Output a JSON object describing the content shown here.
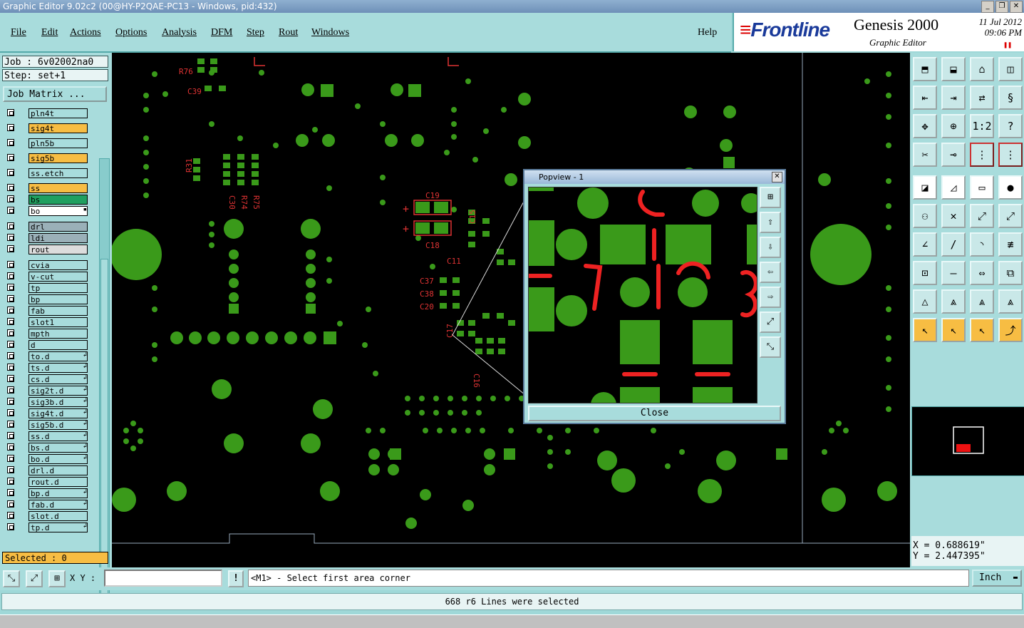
{
  "window": {
    "title": "Graphic Editor 9.02c2 (00@HY-P2QAE-PC13 - Windows, pid:432)",
    "btn_min": "_",
    "btn_max": "❐",
    "btn_close": "✕"
  },
  "menu": {
    "items": [
      "File",
      "Edit",
      "Actions",
      "Options",
      "Analysis",
      "DFM",
      "Step",
      "Rout",
      "Windows"
    ],
    "help": "Help"
  },
  "brand": {
    "logo": "Frontline",
    "logo_mark": "≡",
    "product": "Genesis 2000",
    "subtitle": "Graphic Editor",
    "date": "11 Jul 2012",
    "time": "09:06 PM",
    "pause_icon": "❚❚"
  },
  "job": {
    "job_line": "Job : 6v02002na0",
    "step_line": "Step: set+1",
    "matrix_button": "Job Matrix ..."
  },
  "layers": [
    {
      "name": "pln4t",
      "color": "#a8dcdc",
      "arrow": ""
    },
    {
      "name": "sig4t",
      "color": "#f7bd43",
      "arrow": ""
    },
    {
      "name": "pln5b",
      "color": "#a8dcdc",
      "arrow": ""
    },
    {
      "name": "sig5b",
      "color": "#f7bd43",
      "arrow": ""
    },
    {
      "name": "ss.etch",
      "color": "#a8dcdc",
      "arrow": ""
    },
    {
      "name": "ss",
      "color": "#f7bd43",
      "arrow": ""
    },
    {
      "name": "bs",
      "color": "#20a060",
      "arrow": ""
    },
    {
      "name": "bo",
      "color": "#ffffff",
      "arrow": "▪"
    },
    {
      "name": "drl",
      "color": "#9ab0b8",
      "arrow": ""
    },
    {
      "name": "ldi",
      "color": "#9ab0b8",
      "arrow": ""
    },
    {
      "name": "rout",
      "color": "#dcdcdc",
      "arrow": ""
    },
    {
      "name": "cvia",
      "color": "#a8dcdc",
      "arrow": ""
    },
    {
      "name": "v-cut",
      "color": "#a8dcdc",
      "arrow": ""
    },
    {
      "name": "tp",
      "color": "#a8dcdc",
      "arrow": ""
    },
    {
      "name": "bp",
      "color": "#a8dcdc",
      "arrow": ""
    },
    {
      "name": "fab",
      "color": "#a8dcdc",
      "arrow": ""
    },
    {
      "name": "slot1",
      "color": "#a8dcdc",
      "arrow": ""
    },
    {
      "name": "mpth",
      "color": "#a8dcdc",
      "arrow": ""
    },
    {
      "name": "d",
      "color": "#a8dcdc",
      "arrow": ""
    },
    {
      "name": "to.d",
      "color": "#a8dcdc",
      "arrow": "↲"
    },
    {
      "name": "ts.d",
      "color": "#a8dcdc",
      "arrow": "↲"
    },
    {
      "name": "cs.d",
      "color": "#a8dcdc",
      "arrow": "↲"
    },
    {
      "name": "sig2t.d",
      "color": "#a8dcdc",
      "arrow": "↲"
    },
    {
      "name": "sig3b.d",
      "color": "#a8dcdc",
      "arrow": "↲"
    },
    {
      "name": "sig4t.d",
      "color": "#a8dcdc",
      "arrow": "↲"
    },
    {
      "name": "sig5b.d",
      "color": "#a8dcdc",
      "arrow": "↲"
    },
    {
      "name": "ss.d",
      "color": "#a8dcdc",
      "arrow": "↲"
    },
    {
      "name": "bs.d",
      "color": "#a8dcdc",
      "arrow": "↲"
    },
    {
      "name": "bo.d",
      "color": "#a8dcdc",
      "arrow": "↲"
    },
    {
      "name": "drl.d",
      "color": "#a8dcdc",
      "arrow": ""
    },
    {
      "name": "rout.d",
      "color": "#a8dcdc",
      "arrow": ""
    },
    {
      "name": "bp.d",
      "color": "#a8dcdc",
      "arrow": "↲"
    },
    {
      "name": "fab.d",
      "color": "#a8dcdc",
      "arrow": "↲"
    },
    {
      "name": "slot.d",
      "color": "#a8dcdc",
      "arrow": ""
    },
    {
      "name": "tp.d",
      "color": "#a8dcdc",
      "arrow": "↲"
    }
  ],
  "selected": "Selected : 0",
  "canvas_labels": {
    "r76": "R76",
    "c39": "C39",
    "r31": "R31",
    "c30": "C30",
    "r74": "R74",
    "r75": "R75",
    "c19": "C19",
    "c18": "C18",
    "c15": "C15",
    "c11": "C11",
    "c37": "C37",
    "c38": "C38",
    "c20": "C20",
    "c17": "C17",
    "c16": "C16",
    "plus": "+"
  },
  "popview": {
    "title": "Popview - 1",
    "close_x": "✕",
    "close_label": "Close",
    "buttons": [
      "⊞",
      "⇧",
      "⇩",
      "⇦",
      "⇨",
      "⤢",
      "⤡"
    ]
  },
  "tools": [
    {
      "icon": "⬒",
      "style": ""
    },
    {
      "icon": "⬓",
      "style": ""
    },
    {
      "icon": "⌂",
      "style": ""
    },
    {
      "icon": "◫",
      "style": ""
    },
    {
      "icon": "⇤",
      "style": ""
    },
    {
      "icon": "⇥",
      "style": ""
    },
    {
      "icon": "⇄",
      "style": ""
    },
    {
      "icon": "§",
      "style": ""
    },
    {
      "icon": "✥",
      "style": ""
    },
    {
      "icon": "⊕",
      "style": ""
    },
    {
      "icon": "1:2",
      "style": ""
    },
    {
      "icon": "?",
      "style": ""
    },
    {
      "icon": "✂",
      "style": ""
    },
    {
      "icon": "⊸",
      "style": ""
    },
    {
      "icon": "⋮",
      "style": "r"
    },
    {
      "icon": "⋮",
      "style": "r"
    },
    {
      "icon": "◪",
      "style": "w"
    },
    {
      "icon": "◿",
      "style": "w"
    },
    {
      "icon": "▭",
      "style": "w"
    },
    {
      "icon": "●",
      "style": "w"
    },
    {
      "icon": "⚇",
      "style": ""
    },
    {
      "icon": "✕",
      "style": ""
    },
    {
      "icon": "⤢",
      "style": ""
    },
    {
      "icon": "⤢",
      "style": ""
    },
    {
      "icon": "∠",
      "style": ""
    },
    {
      "icon": "/",
      "style": ""
    },
    {
      "icon": "◝",
      "style": ""
    },
    {
      "icon": "≢",
      "style": ""
    },
    {
      "icon": "⊡",
      "style": ""
    },
    {
      "icon": "—",
      "style": ""
    },
    {
      "icon": "⇔",
      "style": ""
    },
    {
      "icon": "⧉",
      "style": ""
    },
    {
      "icon": "△",
      "style": ""
    },
    {
      "icon": "⩓",
      "style": ""
    },
    {
      "icon": "⩓",
      "style": ""
    },
    {
      "icon": "⩓",
      "style": ""
    },
    {
      "icon": "↖",
      "style": "o"
    },
    {
      "icon": "↖",
      "style": "o"
    },
    {
      "icon": "↖",
      "style": "o"
    },
    {
      "icon": "⤴",
      "style": "o"
    }
  ],
  "coords": {
    "x": "X = 0.688619\"",
    "y": "Y = 2.447395\""
  },
  "bottom": {
    "xy_label": "X Y :",
    "xy_value": "",
    "warn_icon": "!",
    "prompt": "<M1> - Select first area corner",
    "unit": "Inch",
    "unit_arrow": "▬",
    "icons": [
      "⤡",
      "⤢",
      "⊞"
    ]
  },
  "status": "668 r6 Lines were selected"
}
